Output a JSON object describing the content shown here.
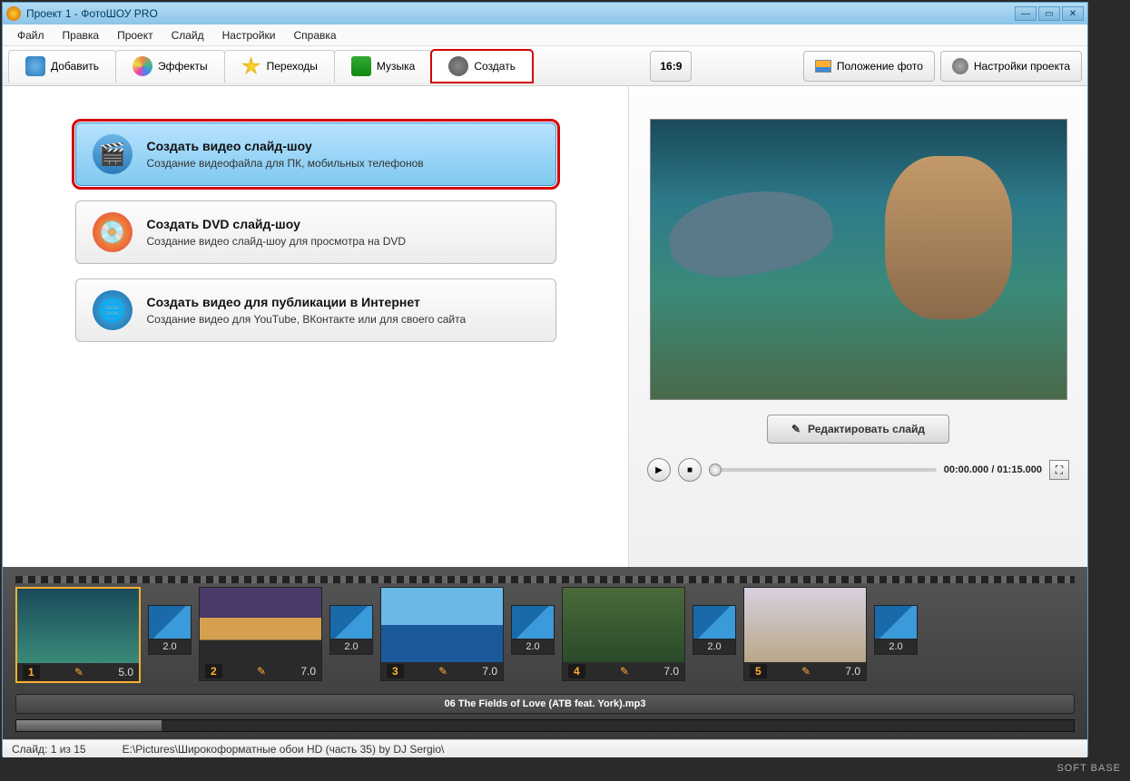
{
  "title": "Проект 1 - ФотоШОУ PRO",
  "menu": [
    "Файл",
    "Правка",
    "Проект",
    "Слайд",
    "Настройки",
    "Справка"
  ],
  "tabs": [
    {
      "label": "Добавить",
      "icon": "camera-icon"
    },
    {
      "label": "Эффекты",
      "icon": "palette-icon"
    },
    {
      "label": "Переходы",
      "icon": "star-icon"
    },
    {
      "label": "Музыка",
      "icon": "music-icon"
    },
    {
      "label": "Создать",
      "icon": "reel-icon"
    }
  ],
  "aspect": "16:9",
  "btn_photo_pos": "Положение фото",
  "btn_proj_settings": "Настройки проекта",
  "options": [
    {
      "title": "Создать видео слайд-шоу",
      "desc": "Создание видеофайла для ПК, мобильных телефонов"
    },
    {
      "title": "Создать DVD слайд-шоу",
      "desc": "Создание видео слайд-шоу для просмотра на DVD"
    },
    {
      "title": "Создать видео для публикации в Интернет",
      "desc": "Создание видео для YouTube, ВКонтакте или для своего сайта"
    }
  ],
  "edit_slide": "Редактировать слайд",
  "time": "00:00.000 / 01:15.000",
  "slides": [
    {
      "n": "1",
      "dur": "5.0",
      "trans": "2.0"
    },
    {
      "n": "2",
      "dur": "7.0",
      "trans": "2.0"
    },
    {
      "n": "3",
      "dur": "7.0",
      "trans": "2.0"
    },
    {
      "n": "4",
      "dur": "7.0",
      "trans": "2.0"
    },
    {
      "n": "5",
      "dur": "7.0",
      "trans": "2.0"
    }
  ],
  "audio_track": "06 The Fields of Love (ATB feat. York).mp3",
  "status_slide": "Слайд: 1 из 15",
  "status_path": "E:\\Pictures\\Широкоформатные обои HD (часть 35) by DJ Sergio\\",
  "watermark": "SOFT BASE"
}
